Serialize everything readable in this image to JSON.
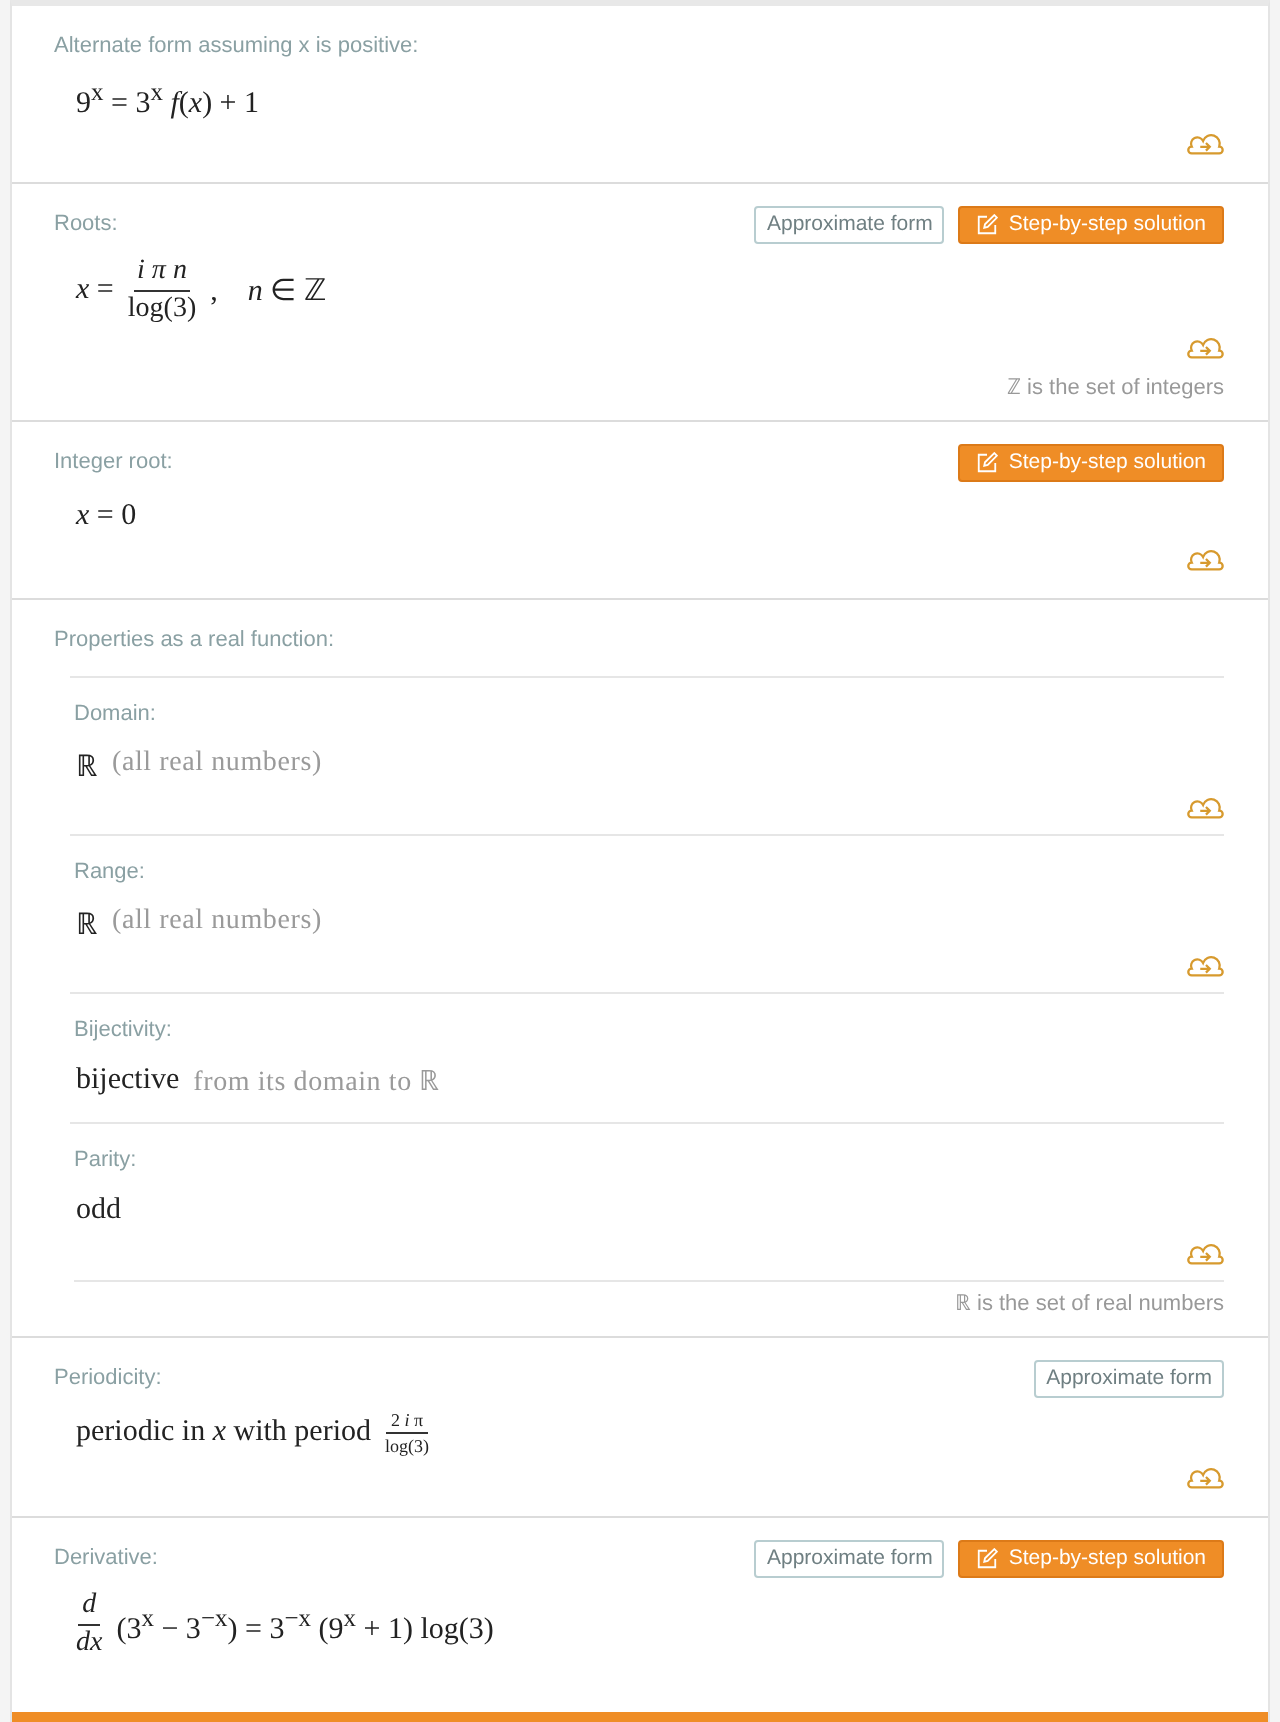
{
  "pods": [
    {
      "title": "Alternate form assuming x is positive:",
      "content": [
        {
          "kind": "math",
          "text": "9$^{x}$ = 3$^{x}$ *f*(*x*) + 1"
        }
      ],
      "save": true
    },
    {
      "title": "Roots:",
      "buttons": [
        {
          "kind": "approx",
          "label": "Approximate form"
        },
        {
          "kind": "step",
          "label": "Step-by-step solution"
        }
      ],
      "content": [
        {
          "kind": "math",
          "text": "*x* ="
        },
        {
          "kind": "frac",
          "num": "*i π n*",
          "den": "log(3)"
        },
        {
          "kind": "math",
          "text": ",    *n* ∈ ℤ"
        }
      ],
      "save": true,
      "footnote": "ℤ is the set of integers"
    },
    {
      "title": "Integer root:",
      "buttons": [
        {
          "kind": "step",
          "label": "Step-by-step solution"
        }
      ],
      "content": [
        {
          "kind": "math",
          "text": "*x* = 0"
        }
      ],
      "save": true
    },
    {
      "title": "Properties as a real function:",
      "subpods": [
        {
          "title": "Domain:",
          "content": [
            {
              "kind": "math",
              "text": "ℝ"
            },
            {
              "kind": "muted",
              "text": "(all real numbers)"
            }
          ],
          "save": true
        },
        {
          "title": "Range:",
          "content": [
            {
              "kind": "math",
              "text": "ℝ"
            },
            {
              "kind": "muted",
              "text": "(all real numbers)"
            }
          ],
          "save": true
        },
        {
          "title": "Bijectivity:",
          "content": [
            {
              "kind": "math",
              "text": "bijective"
            },
            {
              "kind": "muted",
              "text": "from its domain to ℝ"
            }
          ]
        },
        {
          "title": "Parity:",
          "content": [
            {
              "kind": "math",
              "text": "odd"
            }
          ],
          "save": true
        }
      ],
      "footnote": "ℝ is the set of real numbers"
    },
    {
      "title": "Periodicity:",
      "buttons": [
        {
          "kind": "approx",
          "label": "Approximate form"
        }
      ],
      "content": [
        {
          "kind": "math",
          "text": "periodic in *x* with period"
        },
        {
          "kind": "smallfrac",
          "num": "2 *i* π",
          "den": "log(3)"
        }
      ],
      "save": true
    },
    {
      "title": "Derivative:",
      "buttons": [
        {
          "kind": "approx",
          "label": "Approximate form"
        },
        {
          "kind": "step",
          "label": "Step-by-step solution"
        }
      ],
      "content": [
        {
          "kind": "frac",
          "num": "*d*",
          "den": "*dx*"
        },
        {
          "kind": "math",
          "text": "(3$^{x}$ − 3$^{−x}$) = 3$^{−x}$ (9$^{x}$ + 1) log(3)"
        }
      ]
    }
  ]
}
